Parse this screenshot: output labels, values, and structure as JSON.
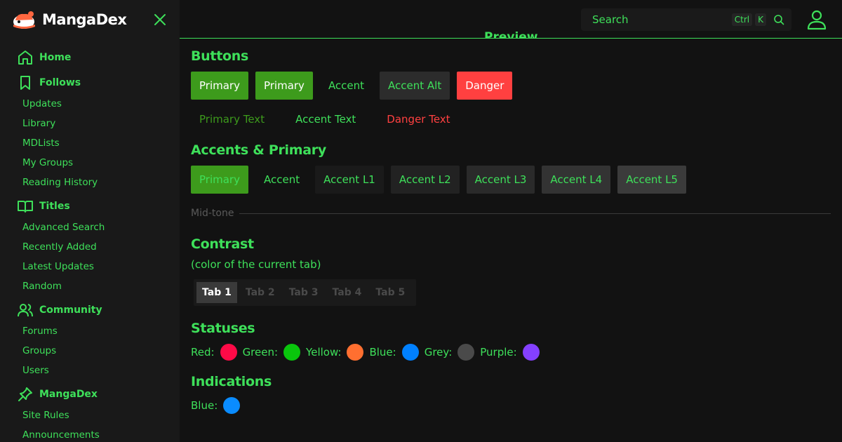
{
  "app": {
    "title": "MangaDex"
  },
  "header": {
    "search_placeholder": "Search",
    "kbd_ctrl": "Ctrl",
    "kbd_k": "K",
    "preview_label": "Preview"
  },
  "sidebar": {
    "sections": [
      {
        "label": "Home",
        "items": []
      },
      {
        "label": "Follows",
        "items": [
          "Updates",
          "Library",
          "MDLists",
          "My Groups",
          "Reading History"
        ]
      },
      {
        "label": "Titles",
        "items": [
          "Advanced Search",
          "Recently Added",
          "Latest Updates",
          "Random"
        ]
      },
      {
        "label": "Community",
        "items": [
          "Forums",
          "Groups",
          "Users"
        ]
      },
      {
        "label": "MangaDex",
        "items": [
          "Site Rules",
          "Announcements"
        ]
      }
    ]
  },
  "buttons": {
    "heading": "Buttons",
    "row1": [
      "Primary",
      "Primary",
      "Accent",
      "Accent Alt",
      "Danger"
    ],
    "row2": [
      "Primary Text",
      "Accent Text",
      "Danger Text"
    ]
  },
  "accents": {
    "heading": "Accents & Primary",
    "items": [
      "Primary",
      "Accent",
      "Accent L1",
      "Accent L2",
      "Accent L3",
      "Accent L4",
      "Accent L5"
    ]
  },
  "midtone": {
    "label": "Mid-tone"
  },
  "contrast": {
    "heading": "Contrast",
    "subtitle": "(color of the current tab)",
    "tabs": [
      "Tab 1",
      "Tab 2",
      "Tab 3",
      "Tab 4",
      "Tab 5"
    ]
  },
  "statuses": {
    "heading": "Statuses",
    "items": [
      {
        "label": "Red:",
        "color": "#ff0a47"
      },
      {
        "label": "Green:",
        "color": "#09c50c"
      },
      {
        "label": "Yellow:",
        "color": "#ff6f30"
      },
      {
        "label": "Blue:",
        "color": "#0080ff"
      },
      {
        "label": "Grey:",
        "color": "#4a4a4a"
      },
      {
        "label": "Purple:",
        "color": "#8440ff"
      }
    ]
  },
  "indications": {
    "heading": "Indications",
    "items": [
      {
        "label": "Blue:",
        "color": "#0a8cff"
      }
    ]
  },
  "colors": {
    "accent": "#3ee05a",
    "primary": "#3d9b1c",
    "danger": "#ff4040",
    "background": "#121212",
    "sidebar": "#191919"
  }
}
